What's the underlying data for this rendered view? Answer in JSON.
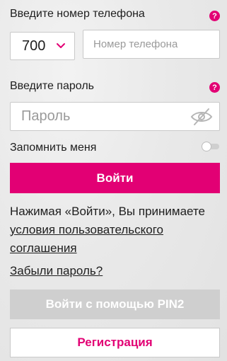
{
  "phone": {
    "label": "Введите номер телефона",
    "help_icon": "question-icon",
    "code_value": "700",
    "code_icon": "chevron-down-icon",
    "number_placeholder": "Номер телефона"
  },
  "password": {
    "label": "Введите пароль",
    "help_icon": "question-icon",
    "placeholder": "Пароль",
    "visibility_icon": "eye-crossed-icon"
  },
  "remember": {
    "label": "Запомнить меня",
    "enabled": false
  },
  "actions": {
    "login_label": "Войти",
    "terms_prefix": "Нажимая «Войти», Вы принимаете",
    "terms_link": "условия пользовательского соглашения",
    "forgot_label": "Забыли пароль?",
    "pin2_label": "Войти с помощью PIN2",
    "register_label": "Регистрация"
  },
  "colors": {
    "brand": "#e20074",
    "disabled": "#cfcfcf",
    "text": "#1e1e1e",
    "placeholder": "#9a9a9a"
  }
}
